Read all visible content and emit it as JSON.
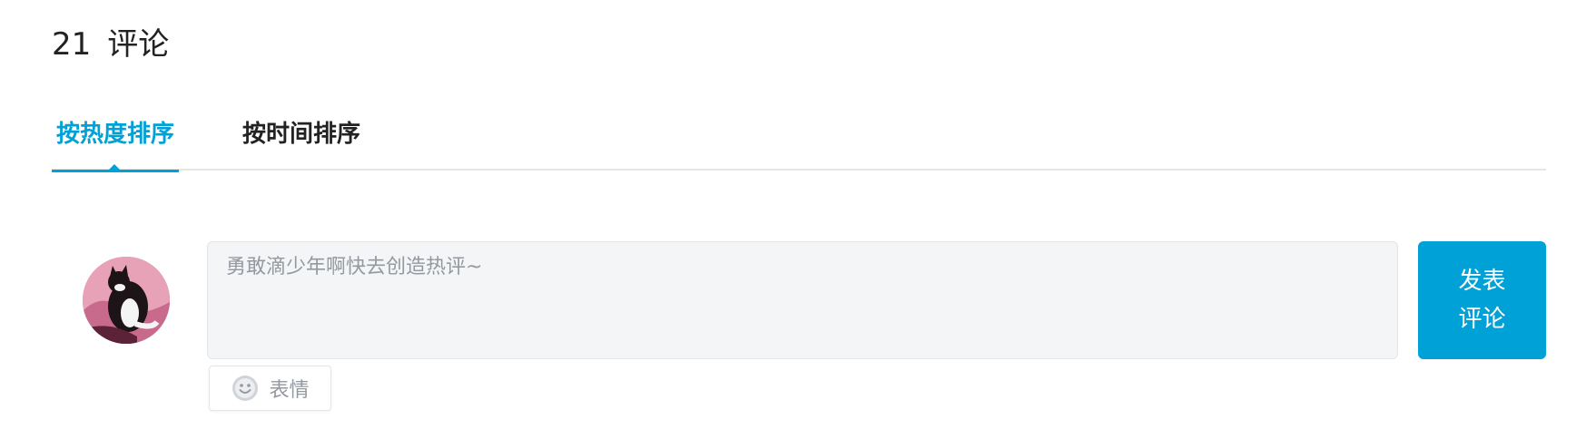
{
  "header": {
    "count": "21",
    "label": "评论"
  },
  "tabs": [
    {
      "label": "按热度排序",
      "active": true
    },
    {
      "label": "按时间排序",
      "active": false
    }
  ],
  "composer": {
    "placeholder": "勇敢滴少年啊快去创造热评~",
    "submit_label": "发表评论",
    "emoji_label": "表情",
    "avatar_icon": "cat-avatar"
  },
  "colors": {
    "accent": "#00a1d6",
    "input_bg": "#f4f5f7",
    "divider": "#e3e5e7"
  }
}
